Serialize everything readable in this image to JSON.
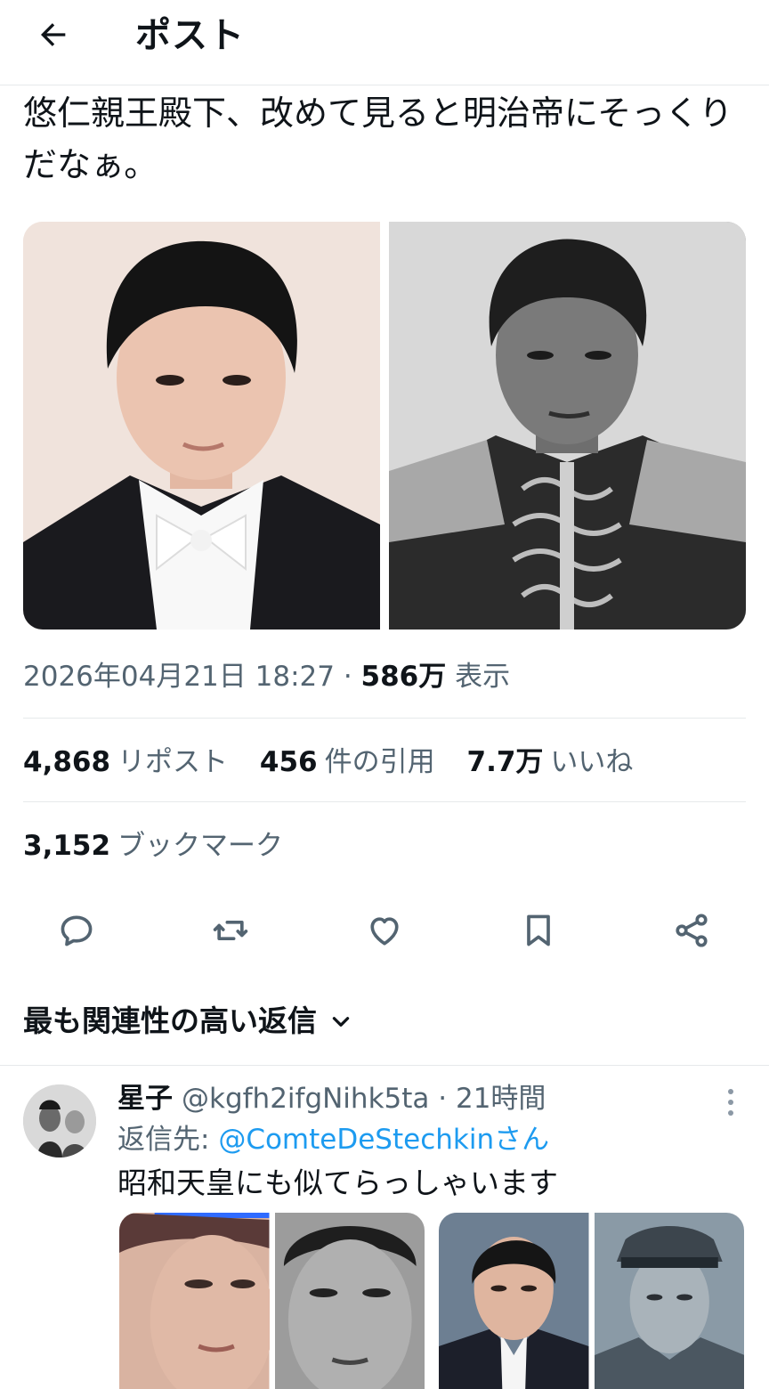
{
  "header": {
    "title": "ポスト",
    "back_icon": "arrow-left-icon"
  },
  "tweet": {
    "text": "悠仁親王殿下、改めて見ると明治帝にそっくりだなぁ。",
    "timestamp": "2026年04月21日 18:27",
    "separator": " · ",
    "views_count": "586万",
    "views_label": " 表示"
  },
  "stats": {
    "reposts_count": "4,868",
    "reposts_label": "リポスト",
    "quotes_count": "456",
    "quotes_label": "件の引用",
    "likes_count": "7.7万",
    "likes_label": "いいね",
    "bookmarks_count": "3,152",
    "bookmarks_label": "ブックマーク"
  },
  "actions": [
    "reply-icon",
    "repost-icon",
    "like-icon",
    "bookmark-icon",
    "share-icon"
  ],
  "sort": {
    "label": "最も関連性の高い返信",
    "icon": "chevron-down-icon"
  },
  "reply": {
    "name": "星子",
    "handle": "@kgfh2ifgNihk5ta",
    "time": "· 21時間",
    "reply_to_prefix": "返信先: ",
    "reply_to_handle": "@ComteDeStechkinさん",
    "text": "昭和天皇にも似てらっしゃいます"
  },
  "colors": {
    "text_primary": "#0f1419",
    "text_secondary": "#536471",
    "accent": "#1d9bf0",
    "divider": "#e6e9eb"
  }
}
